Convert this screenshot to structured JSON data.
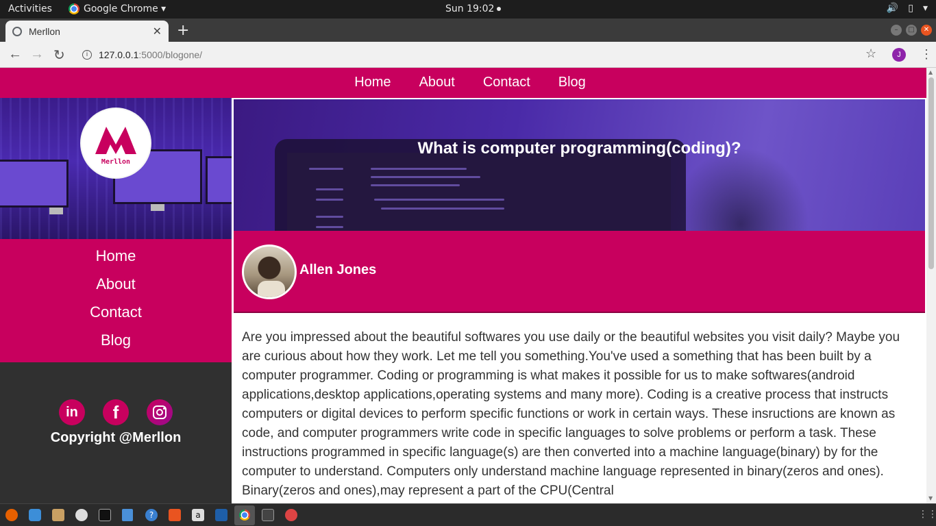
{
  "desktop": {
    "activities": "Activities",
    "app_menu": "Google Chrome ▾",
    "clock": "Sun 19:02"
  },
  "browser": {
    "tab_title": "Merllon",
    "url_host": "127.0.0.1",
    "url_path": ":5000/blogone/",
    "profile_initial": "J"
  },
  "topnav": {
    "items": [
      "Home",
      "About",
      "Contact",
      "Blog"
    ]
  },
  "sidebar": {
    "logo_text": "Merllon",
    "menu": [
      "Home",
      "About",
      "Contact",
      "Blog"
    ],
    "social": [
      "linkedin",
      "facebook",
      "instagram"
    ],
    "copyright": "Copyright @Merllon"
  },
  "post": {
    "title": "What is computer programming(coding)?",
    "author": "Allen Jones",
    "body": "Are you impressed about the beautiful softwares you use daily or the beautiful websites you visit daily? Maybe you are curious about how they work. Let me tell you something.You've used a something that has been built by a computer programmer. Coding or programming is what makes it possible for us to make softwares(android applications,desktop applications,operating systems and many more). Coding is a creative process that instructs computers or digital devices to perform specific functions or work in certain ways. These insructions are known as code, and computer programmers write code in specific languages to solve problems or perform a task. These instructions programmed in specific language(s) are then converted into a machine language(binary) by for the computer to understand. Computers only understand machine language represented in binary(zeros and ones). Binary(zeros and ones),may represent a part of the CPU(Central"
  },
  "colors": {
    "accent": "#c8005e",
    "sidebar_bg": "#303030"
  }
}
